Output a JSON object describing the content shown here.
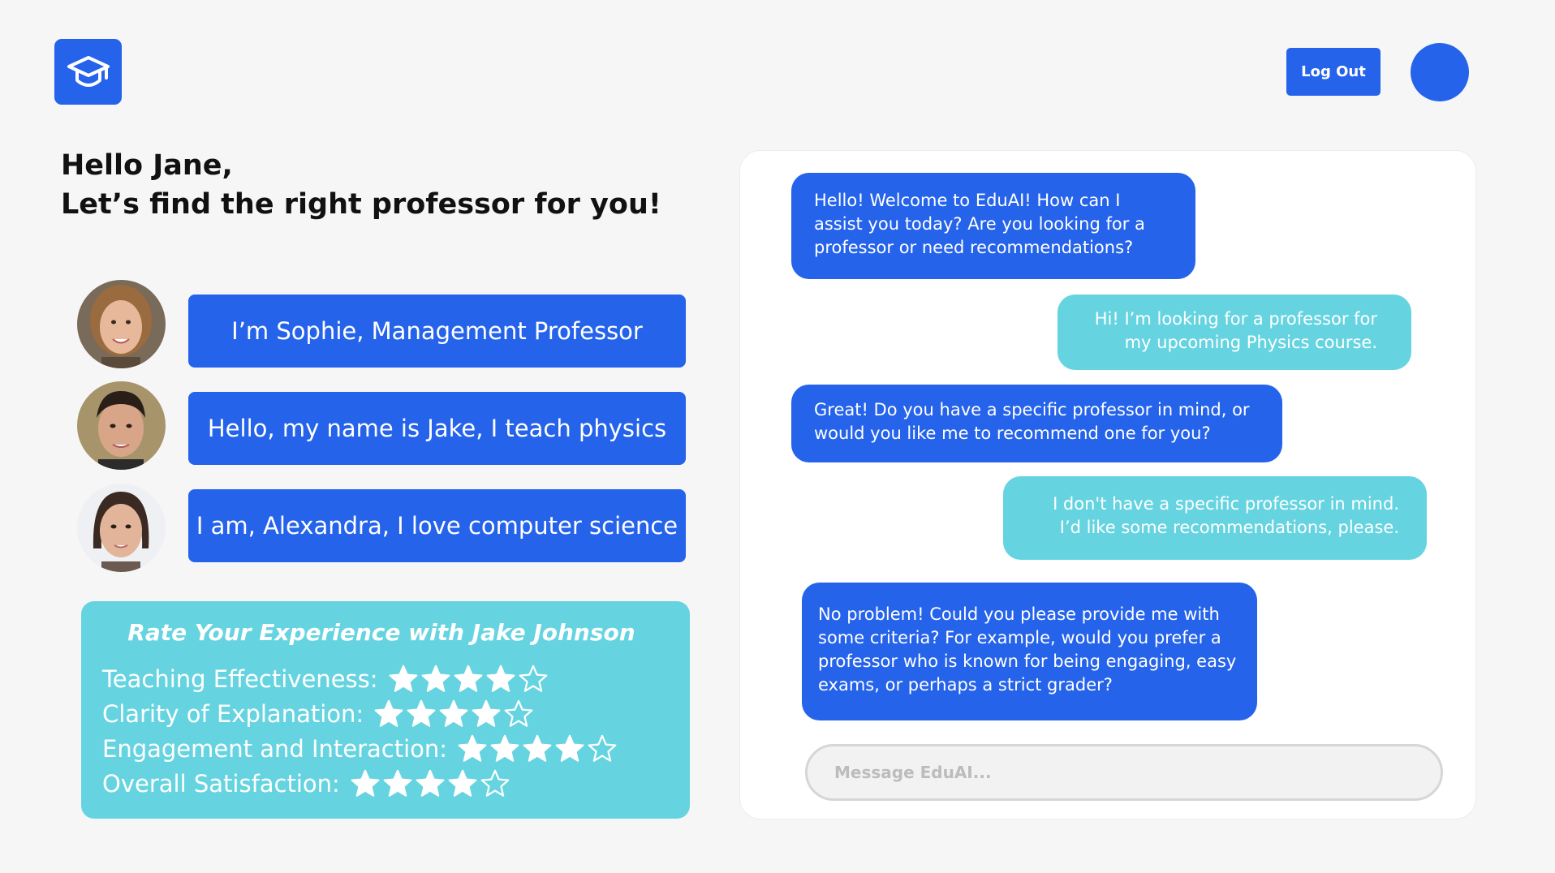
{
  "app": {
    "logo_icon": "graduation-cap-icon",
    "accent_color": "#2563eb",
    "secondary_color": "#66d4e0"
  },
  "header": {
    "logout_label": "Log Out"
  },
  "greeting": {
    "line1": "Hello Jane,",
    "line2": "Let’s find the right professor for you!"
  },
  "professors": [
    {
      "label": "I’m Sophie, Management Professor"
    },
    {
      "label": "Hello, my name is Jake, I teach physics"
    },
    {
      "label": "I am, Alexandra, I love computer science"
    }
  ],
  "rating": {
    "title": "Rate Your Experience with Jake Johnson",
    "items": [
      {
        "label": "Teaching Effectiveness:",
        "stars": 4,
        "max": 5
      },
      {
        "label": "Clarity of Explanation:",
        "stars": 4,
        "max": 5
      },
      {
        "label": "Engagement and Interaction:",
        "stars": 4,
        "max": 5
      },
      {
        "label": "Overall Satisfaction:",
        "stars": 4,
        "max": 5
      }
    ]
  },
  "chat": {
    "messages": [
      {
        "role": "bot",
        "text": "Hello! Welcome to EduAI! How can I assist you today? Are you looking for a professor or need recommendations?"
      },
      {
        "role": "user",
        "text": "Hi! I’m looking for a professor for my upcoming Physics course."
      },
      {
        "role": "bot",
        "text": "Great! Do you have a specific professor in mind, or would you like me to recommend one for you?"
      },
      {
        "role": "user",
        "text": "I don't have a specific professor in mind. I’d like some recommendations, please."
      },
      {
        "role": "bot",
        "text": "No problem! Could you please provide me with some criteria? For example, would you prefer a professor who is known for being engaging, easy exams, or perhaps a strict grader?"
      }
    ],
    "input_placeholder": "Message EduAI..."
  }
}
